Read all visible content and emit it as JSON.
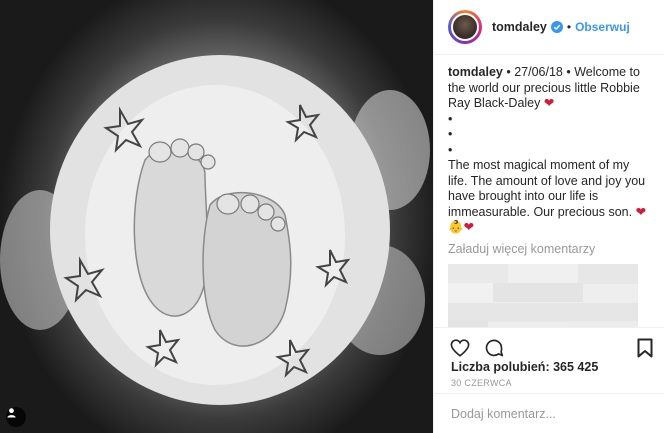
{
  "post": {
    "username": "tomdaley",
    "follow_label": "Obserwuj",
    "caption_user": "tomdaley",
    "caption_line1": " • 27/06/18 • Welcome to the world our precious little Robbie Ray Black-Daley ",
    "caption_heart": "❤",
    "bullets": [
      "•",
      "•",
      "•"
    ],
    "caption_line2": "The most magical moment of my life. The amount of love and joy you have brought into our life is immeasurable. Our precious son. ",
    "caption_emoji": "❤👶❤",
    "load_more": "Załaduj więcej komentarzy",
    "likes_label": "Liczba polubień: 365 425",
    "date_label": "30 CZERWCA",
    "add_comment_placeholder": "Dodaj komentarz..."
  },
  "colors": {
    "accent": "#3897f0",
    "heart": "#d4193a",
    "verified": "#3897f0"
  },
  "icons": [
    "user-tag-icon",
    "verified-icon",
    "heart-icon",
    "comment-icon",
    "bookmark-icon"
  ]
}
